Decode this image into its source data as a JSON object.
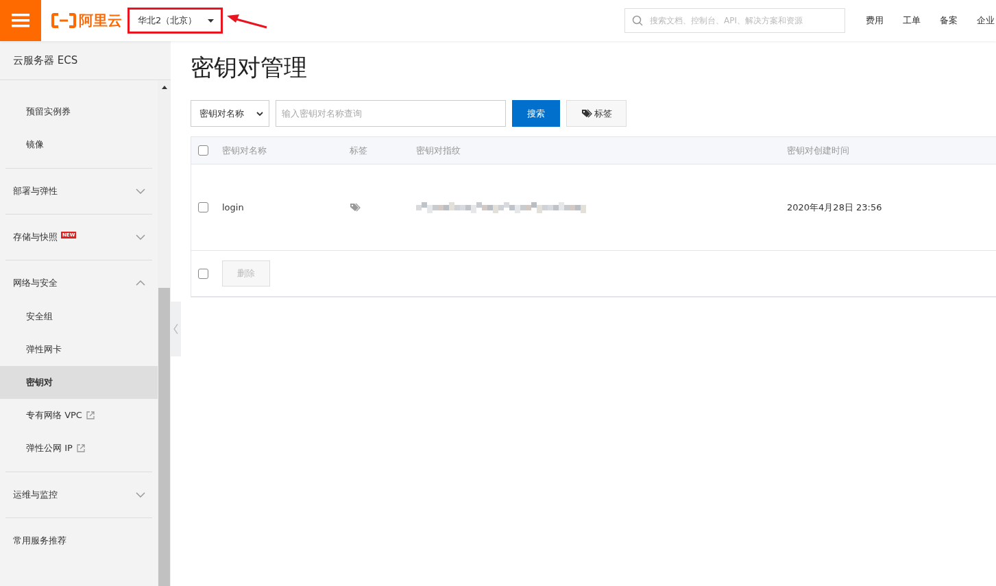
{
  "header": {
    "region": "华北2（北京）",
    "search": {
      "placeholder": "搜索文档、控制台、API、解决方案和资源"
    },
    "links": [
      "费用",
      "工单",
      "备案",
      "企业"
    ],
    "logo": "阿里云"
  },
  "sidebar": {
    "title": "云服务器 ECS",
    "items_above": [
      {
        "label": "预留实例券",
        "selected": false
      },
      {
        "label": "镜像",
        "selected": false
      }
    ],
    "sections": [
      {
        "label": "部署与弹性",
        "kind": "group",
        "expanded": false
      },
      {
        "label": "存储与快照",
        "kind": "group",
        "expanded": false,
        "badge": "NEW"
      },
      {
        "label": "网络与安全",
        "kind": "group",
        "expanded": true,
        "children": [
          {
            "label": "安全组",
            "selected": false,
            "external": false
          },
          {
            "label": "弹性网卡",
            "selected": false,
            "external": false
          },
          {
            "label": "密钥对",
            "selected": true,
            "external": false
          },
          {
            "label": "专有网络 VPC",
            "selected": false,
            "external": true
          },
          {
            "label": "弹性公网 IP",
            "selected": false,
            "external": true
          }
        ]
      },
      {
        "label": "运维与监控",
        "kind": "group",
        "expanded": false
      },
      {
        "label": "常用服务推荐",
        "kind": "plain"
      }
    ]
  },
  "page": {
    "title": "密钥对管理",
    "filter": {
      "field": "密钥对名称",
      "placeholder": "输入密钥对名称查询",
      "search_button": "搜索",
      "tag_button": "标签"
    },
    "table": {
      "all_checked": false,
      "columns": [
        "密钥对名称",
        "标签",
        "密钥对指纹",
        "密钥对创建时间"
      ],
      "rows": [
        {
          "checked": false,
          "name": "login",
          "created": "2020年4月28日 23:56"
        }
      ],
      "footer": {
        "checked": false,
        "delete_button": "删除",
        "delete_disabled": true
      }
    }
  }
}
